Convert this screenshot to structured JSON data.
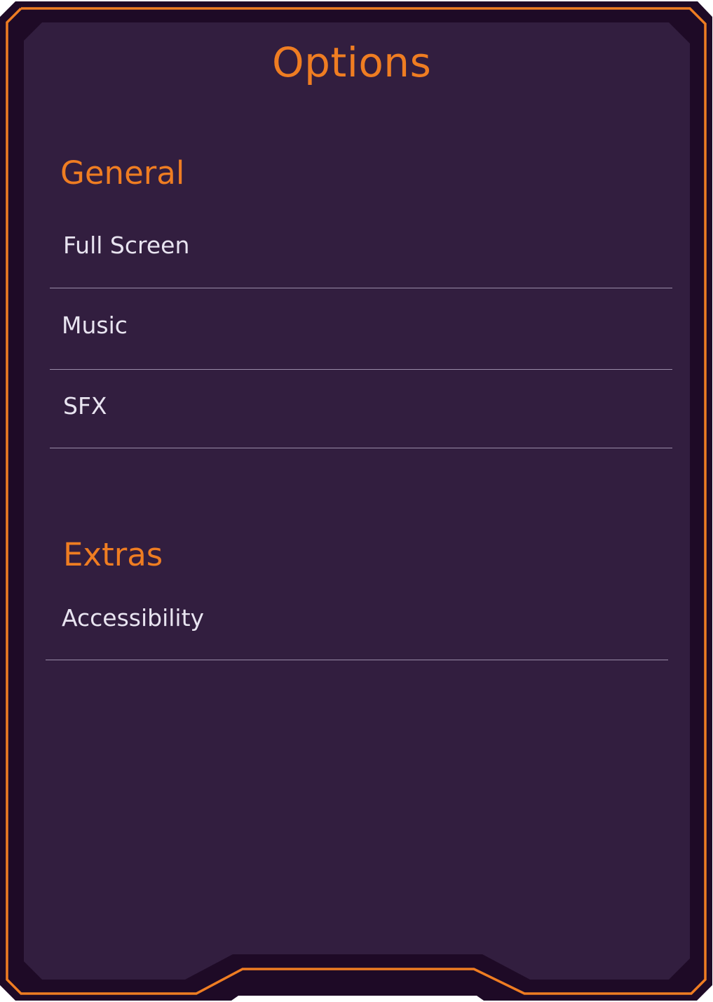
{
  "panel": {
    "title": "Options"
  },
  "sections": [
    {
      "heading": "General",
      "items": [
        "Full Screen",
        "Music",
        "SFX"
      ]
    },
    {
      "heading": "Extras",
      "items": [
        "Accessibility"
      ]
    }
  ],
  "colors": {
    "accent": "#ef7d22",
    "panel_bg": "#321e3f",
    "outer_bg": "#1e0a26",
    "text": "#e8e4f0",
    "divider": "#9a8ca8"
  }
}
